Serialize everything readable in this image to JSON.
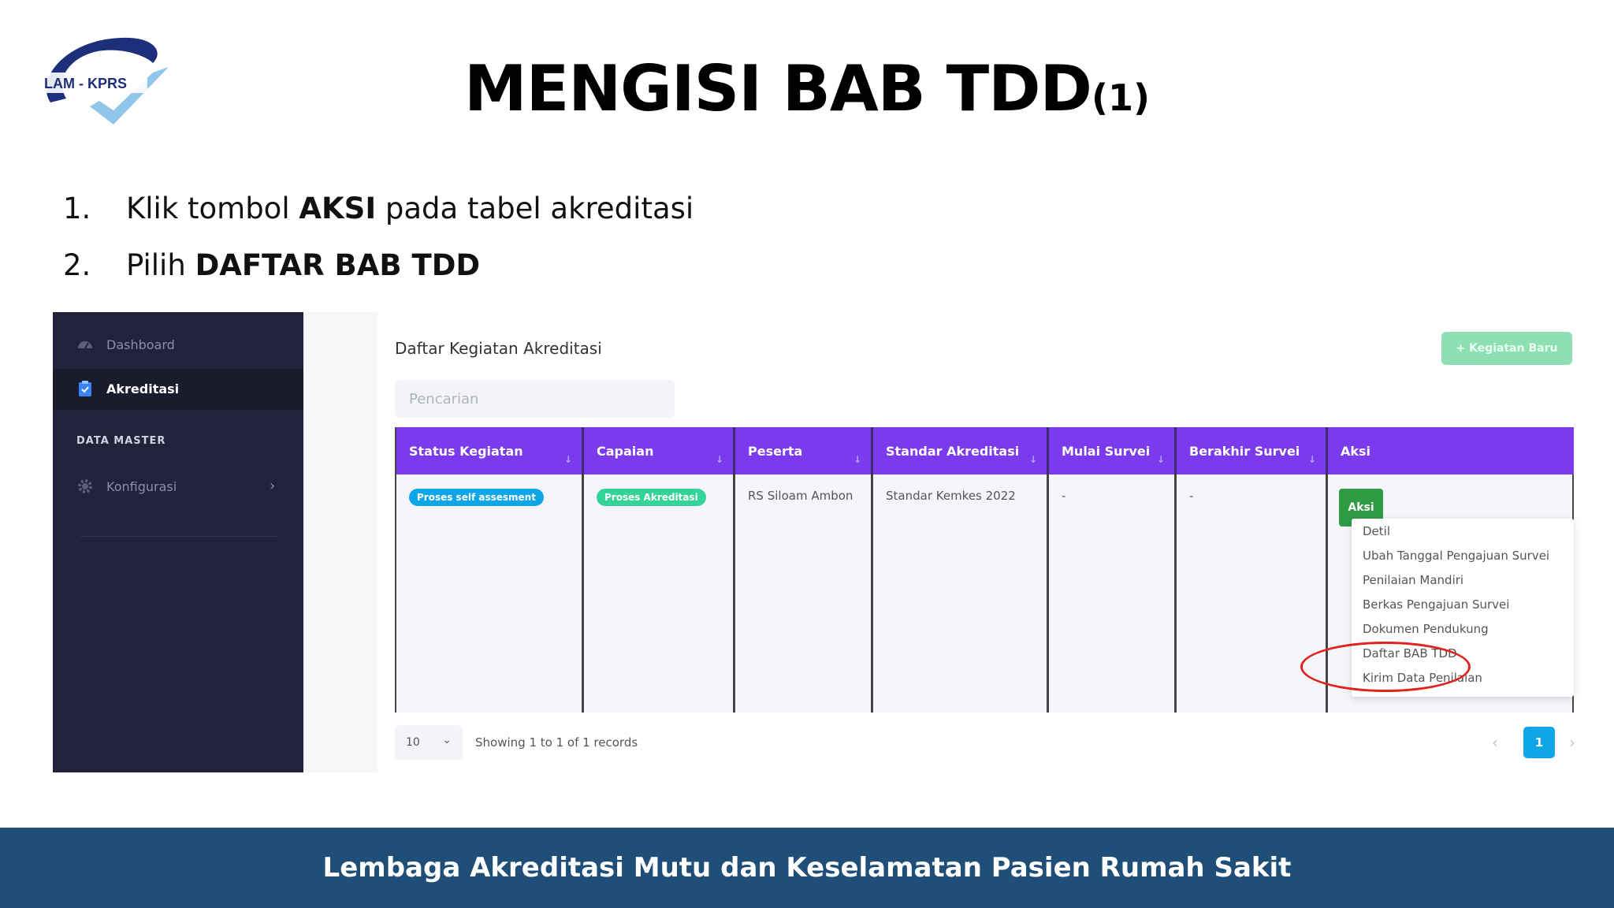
{
  "logo": {
    "text": "LAM - KPRS"
  },
  "title": {
    "main": "MENGISI BAB TDD",
    "sub": "(1)"
  },
  "steps": [
    {
      "num": "1.",
      "pre": "Klik tombol ",
      "bold": "AKSI",
      "post": " pada tabel akreditasi"
    },
    {
      "num": "2.",
      "pre": "Pilih ",
      "bold": "DAFTAR BAB TDD",
      "post": ""
    }
  ],
  "sidebar": {
    "dashboard": "Dashboard",
    "akreditasi": "Akreditasi",
    "section": "DATA MASTER",
    "konfigurasi": "Konfigurasi",
    "chevron": "›"
  },
  "content": {
    "heading": "Daftar Kegiatan Akreditasi",
    "new_button": "+ Kegiatan Baru",
    "search_placeholder": "Pencarian"
  },
  "table": {
    "headers": [
      "Status Kegiatan",
      "Capaian",
      "Peserta",
      "Standar Akreditasi",
      "Mulai Survei",
      "Berakhir Survei",
      "Aksi"
    ],
    "sort_glyph": "↓",
    "row": {
      "status": "Proses self assesment",
      "capaian": "Proses Akreditasi",
      "peserta": "RS Siloam Ambon",
      "standar": "Standar Kemkes 2022",
      "mulai": "-",
      "berakhir": "-",
      "aksi_button": "Aksi"
    }
  },
  "menu": [
    "Detil",
    "Ubah Tanggal Pengajuan Survei",
    "Penilaian Mandiri",
    "Berkas Pengajuan Survei",
    "Dokumen Pendukung",
    "Daftar BAB TDD",
    "Kirim Data Penilaian"
  ],
  "footer": {
    "page_size": "10",
    "records": "Showing 1 to 1 of 1 records",
    "prev": "‹",
    "page": "1",
    "next": "›"
  },
  "banner": "Lembaga Akreditasi Mutu dan Keselamatan Pasien Rumah Sakit",
  "colors": {
    "sidebar": "#22223a",
    "table_header": "#7c3aed",
    "aksi_green": "#2f9b45",
    "badge_blue": "#0ea5e9",
    "badge_green": "#34d399",
    "highlight": "#e0231f",
    "banner": "#1f4e79"
  }
}
